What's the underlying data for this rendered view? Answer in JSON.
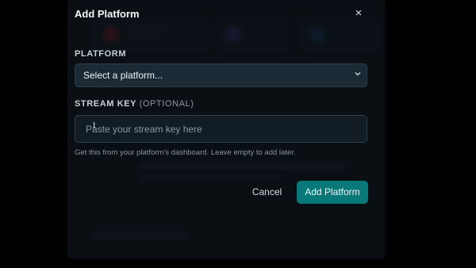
{
  "modal": {
    "title": "Add Platform",
    "close_glyph": "×",
    "platform_label": "PLATFORM",
    "platform_select": {
      "selected": "Select a platform...",
      "chevron": "⌄"
    },
    "stream_key_label": "STREAM KEY",
    "stream_key_optional": "(OPTIONAL)",
    "stream_key_input": {
      "value": "",
      "placeholder": "Paste your stream key here"
    },
    "hint": "Get this from your platform's dashboard. Leave empty to add later.",
    "cancel_label": "Cancel",
    "submit_label": "Add Platform"
  },
  "colors": {
    "accent": "#087878",
    "modal_bg": "#0d151b",
    "field_bg": "#1c2a35"
  },
  "icons": {
    "close": "close-icon",
    "chevron": "chevron-down-icon",
    "cursor": "text-cursor-icon"
  }
}
